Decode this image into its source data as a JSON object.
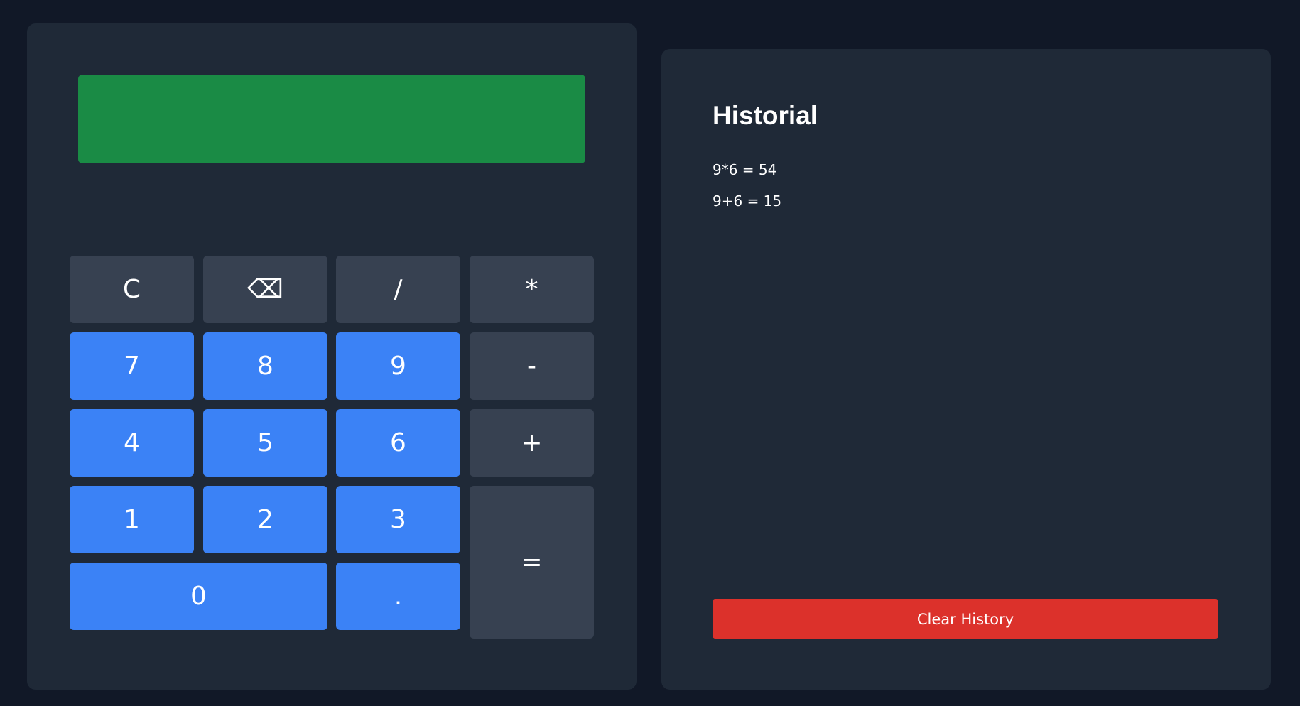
{
  "calculator": {
    "display_value": "",
    "colors": {
      "display": "#1a8b45",
      "number_key": "#3b82f6",
      "function_key": "#374151"
    },
    "keys": {
      "clear": "C",
      "backspace": "⌫",
      "divide": "/",
      "multiply": "*",
      "seven": "7",
      "eight": "8",
      "nine": "9",
      "subtract": "-",
      "four": "4",
      "five": "5",
      "six": "6",
      "add": "+",
      "one": "1",
      "two": "2",
      "three": "3",
      "equals": "=",
      "zero": "0",
      "decimal": "."
    }
  },
  "history": {
    "title": "Historial",
    "entries": [
      "9*6 = 54",
      "9+6 = 15"
    ],
    "clear_label": "Clear History",
    "clear_color": "#dc312b"
  }
}
